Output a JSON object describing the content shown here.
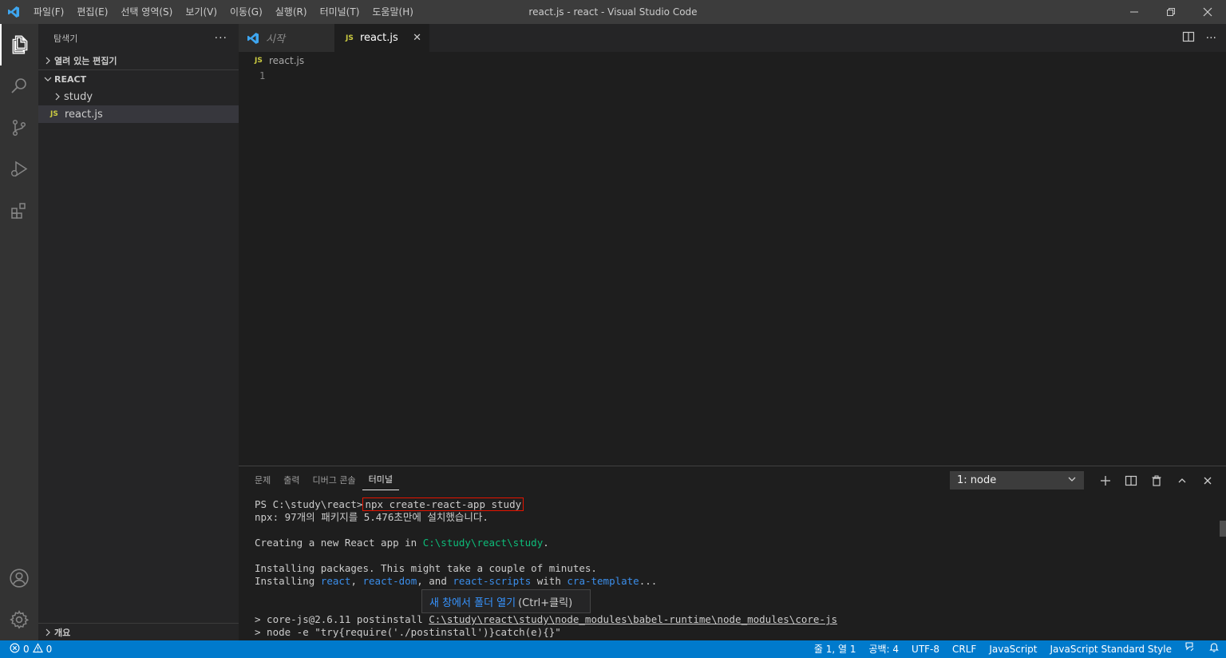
{
  "window": {
    "title": "react.js - react - Visual Studio Code",
    "menu": [
      "파일(F)",
      "편집(E)",
      "선택 영역(S)",
      "보기(V)",
      "이동(G)",
      "실행(R)",
      "터미널(T)",
      "도움말(H)"
    ]
  },
  "activity_bar": {
    "icons": [
      "explorer-icon",
      "search-icon",
      "source-control-icon",
      "run-debug-icon",
      "extensions-icon",
      "account-icon",
      "settings-gear-icon"
    ]
  },
  "sidebar": {
    "title": "탐색기",
    "more": "···",
    "open_editors": "열려 있는 편집기",
    "folder": "REACT",
    "items": [
      {
        "label": "study",
        "kind": "folder"
      },
      {
        "label": "react.js",
        "kind": "js",
        "badge": "JS"
      }
    ],
    "outline": "개요"
  },
  "tabs": [
    {
      "label": "시작",
      "active": false
    },
    {
      "label": "react.js",
      "badge": "JS",
      "active": true,
      "close": "✕"
    }
  ],
  "breadcrumb": {
    "badge": "JS",
    "file": "react.js"
  },
  "editor": {
    "line_numbers": [
      "1"
    ]
  },
  "panel": {
    "tabs": [
      "문제",
      "출력",
      "디버그 콘솔",
      "터미널"
    ],
    "active_tab": "터미널",
    "terminal_select": "1: node",
    "terminal": {
      "prompt": "PS C:\\study\\react>",
      "command": "npx create-react-app study",
      "line_npx": "npx: 97개의 패키지를 5.476초만에 설치했습니다.",
      "creating_pre": "Creating a new React app in ",
      "creating_path": "C:\\study\\react\\study",
      "creating_post": ".",
      "installing_1": "Installing packages. This might take a couple of minutes.",
      "installing_2_pre": "Installing ",
      "pkg_react": "react",
      "sep1": ", ",
      "pkg_react_dom": "react-dom",
      "sep2": ", and ",
      "pkg_scripts": "react-scripts",
      "with": " with ",
      "pkg_template": "cra-template",
      "ellipsis": "...",
      "corejs_pre": "> core-js@2.6.11 postinstall ",
      "corejs_path": "C:\\study\\react\\study\\node_modules\\babel-runtime\\node_modules\\core-js",
      "node_line": "> node -e \"try{require('./postinstall')}catch(e){}\""
    },
    "tooltip": {
      "link": "새 창에서 폴더 열기",
      "hint": "(Ctrl+클릭)"
    }
  },
  "statusbar": {
    "errors": "0",
    "warnings": "0",
    "position": "줄 1, 열 1",
    "spaces": "공백: 4",
    "encoding": "UTF-8",
    "eol": "CRLF",
    "language": "JavaScript",
    "linter": "JavaScript Standard Style"
  },
  "colors": {
    "accent": "#007acc",
    "title_bar": "#3c3c3c",
    "activity_bar": "#333333",
    "sidebar": "#252526",
    "editor": "#1e1e1e",
    "terminal_green": "#0dbc79",
    "terminal_blue": "#3b8eea",
    "highlight_box": "#e51400",
    "js_badge": "#cbcb41"
  }
}
